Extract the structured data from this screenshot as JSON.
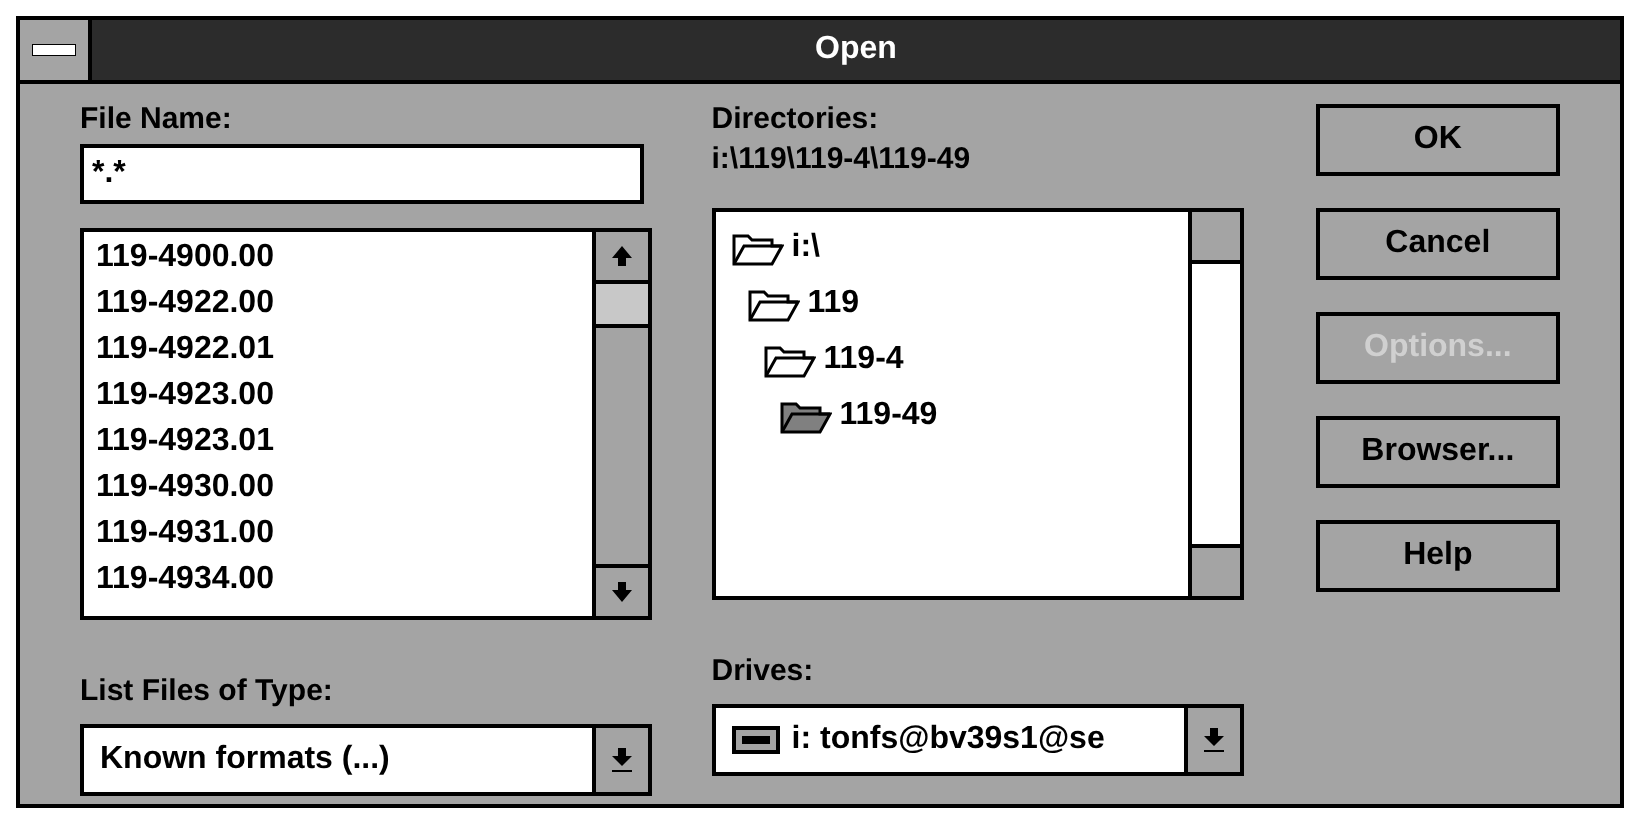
{
  "window": {
    "title": "Open"
  },
  "file_name": {
    "label": "File Name:",
    "value": "*.*"
  },
  "files": {
    "items": [
      {
        "name": "119-4900.00",
        "selected": false
      },
      {
        "name": "119-4922.00",
        "selected": false
      },
      {
        "name": "119-4922.01",
        "selected": false
      },
      {
        "name": "119-4923.00",
        "selected": false
      },
      {
        "name": "119-4923.01",
        "selected": false
      },
      {
        "name": "119-4930.00",
        "selected": false
      },
      {
        "name": "119-4931.00",
        "selected": false
      },
      {
        "name": "119-4934.00",
        "selected": false
      }
    ]
  },
  "file_type": {
    "label": "List Files of Type:",
    "value": "Known formats (...)"
  },
  "directories": {
    "label": "Directories:",
    "path": "i:\\119\\119-4\\119-49",
    "tree": [
      {
        "name": "i:\\",
        "selected": false,
        "children": [
          {
            "name": "119",
            "selected": false,
            "children": [
              {
                "name": "119-4",
                "selected": false,
                "children": [
                  {
                    "name": "119-49",
                    "selected": true
                  }
                ]
              }
            ]
          }
        ]
      }
    ]
  },
  "drives": {
    "label": "Drives:",
    "value": "i: tonfs@bv39s1@se"
  },
  "buttons": [
    {
      "label": "OK",
      "disabled": false
    },
    {
      "label": "Cancel",
      "disabled": false
    },
    {
      "label": "Options...",
      "disabled": true
    },
    {
      "label": "Browser...",
      "disabled": false
    },
    {
      "label": "Help",
      "disabled": false
    }
  ]
}
